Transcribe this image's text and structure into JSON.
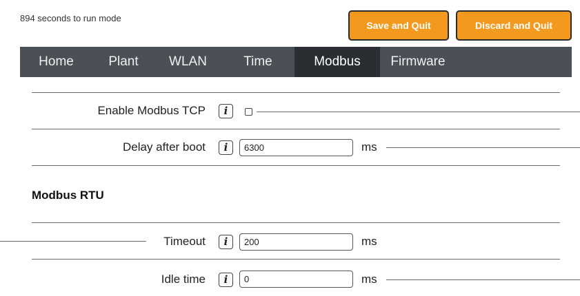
{
  "status_text": "894 seconds to run mode",
  "buttons": {
    "save": "Save and Quit",
    "discard": "Discard and Quit"
  },
  "nav": {
    "tabs": [
      {
        "label": "Home"
      },
      {
        "label": "Plant"
      },
      {
        "label": "WLAN"
      },
      {
        "label": "Time"
      },
      {
        "label": "Modbus"
      },
      {
        "label": "Firmware"
      }
    ],
    "active": "Modbus"
  },
  "settings": {
    "enable_tcp": {
      "label": "Enable Modbus TCP",
      "checked": false
    },
    "delay_after_boot": {
      "label": "Delay after boot",
      "value": "6300",
      "unit": "ms"
    },
    "rtu_section": "Modbus RTU",
    "timeout": {
      "label": "Timeout",
      "value": "200",
      "unit": "ms"
    },
    "idle_time": {
      "label": "Idle time",
      "value": "0",
      "unit": "ms"
    }
  },
  "info_glyph": "i",
  "colors": {
    "accent": "#f39a1e",
    "nav_bg": "#4b5057",
    "nav_active": "#2a2e33"
  }
}
